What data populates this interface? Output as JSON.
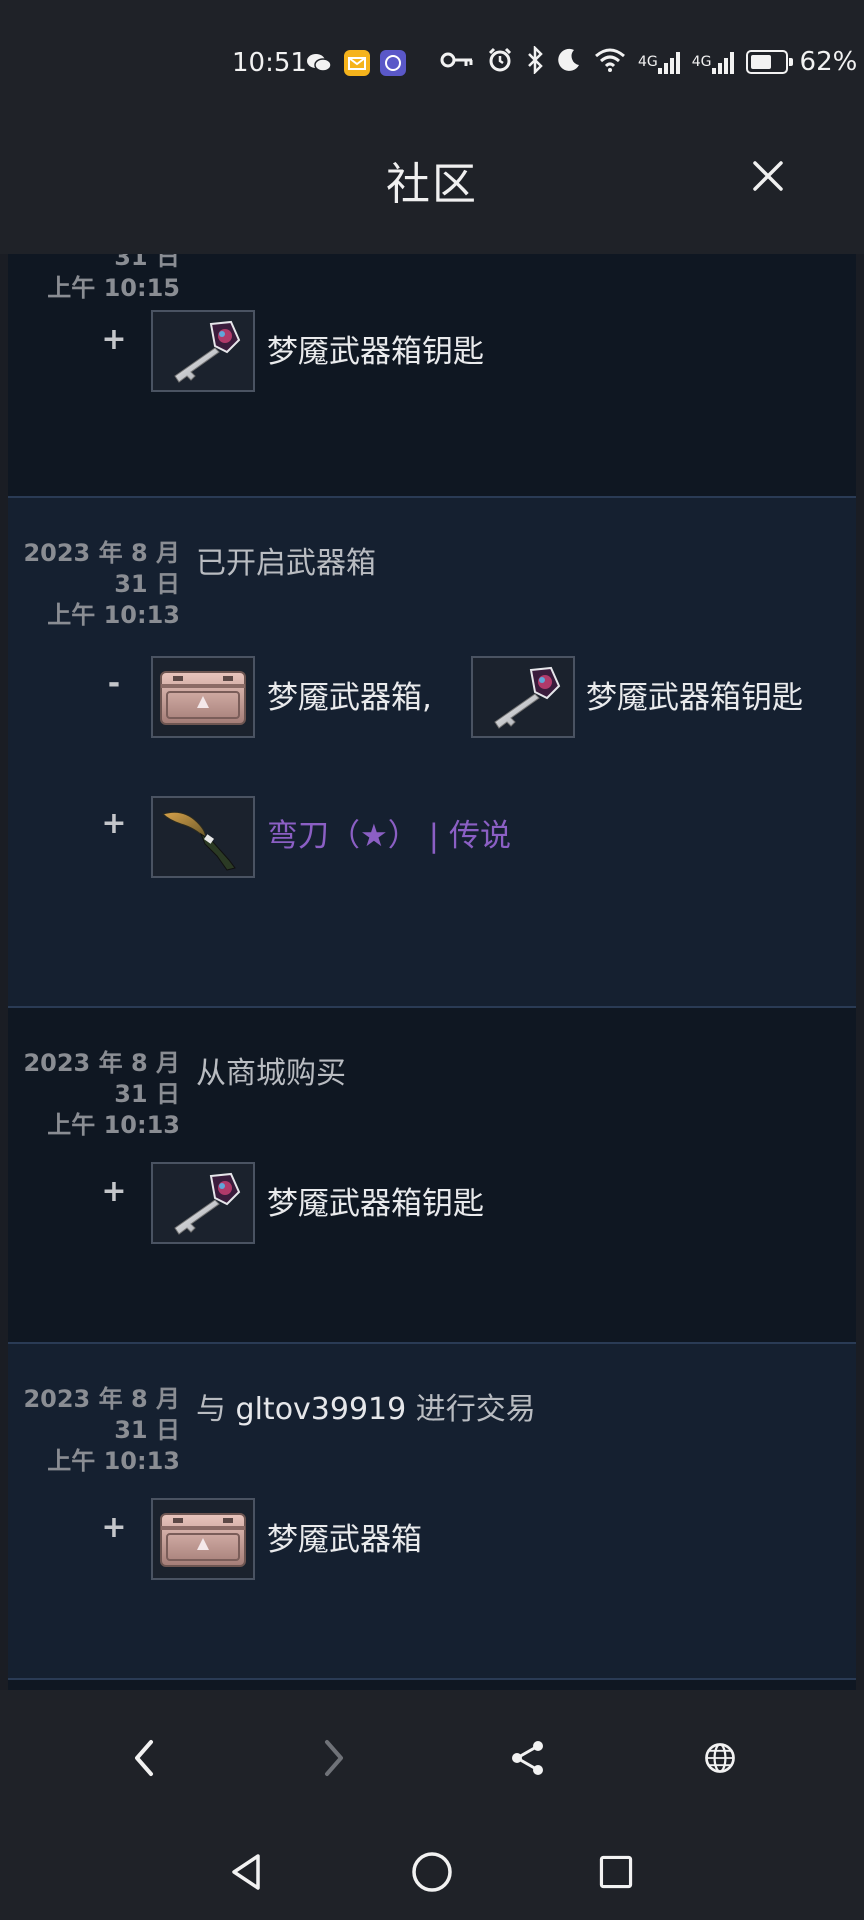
{
  "status_bar": {
    "time": "10:51",
    "battery_pct": "62%",
    "battery_level": 0.62,
    "signal_1": "4G",
    "signal_2": "4G",
    "icons": [
      "wechat-icon",
      "mail-icon",
      "app-icon",
      "key-icon",
      "alarm-icon",
      "bluetooth-icon",
      "moon-icon",
      "wifi-icon",
      "signal-icon",
      "signal-icon",
      "battery-icon"
    ]
  },
  "header": {
    "title": "社区",
    "close_icon": "close-icon"
  },
  "entries": [
    {
      "date_partial": "31 日",
      "time": "上午 10:15",
      "items": [
        {
          "sign": "+",
          "name": "梦魇武器箱钥匙",
          "thumb": "key"
        }
      ]
    },
    {
      "date_line1": "2023 年 8 月",
      "date_line2": "31 日",
      "time": "上午 10:13",
      "description": "已开启武器箱",
      "removed": {
        "sign": "-",
        "items": [
          {
            "name": "梦魇武器箱,",
            "thumb": "case"
          },
          {
            "name": "梦魇武器箱钥匙",
            "thumb": "key"
          }
        ]
      },
      "added": {
        "sign": "+",
        "name": "弯刀（★） | 传说",
        "thumb": "knife",
        "color": "#8b5fc4"
      }
    },
    {
      "date_line1": "2023 年 8 月",
      "date_line2": "31 日",
      "time": "上午 10:13",
      "description": "从商城购买",
      "items": [
        {
          "sign": "+",
          "name": "梦魇武器箱钥匙",
          "thumb": "key"
        }
      ]
    },
    {
      "date_line1": "2023 年 8 月",
      "date_line2": "31 日",
      "time": "上午 10:13",
      "description_prefix": "与",
      "description_user": "gltov39919",
      "description_suffix": "进行交易",
      "items": [
        {
          "sign": "+",
          "name": "梦魇武器箱",
          "thumb": "case"
        }
      ]
    }
  ],
  "browser_bar": {
    "buttons": [
      "back-icon",
      "forward-icon",
      "share-icon",
      "globe-icon"
    ]
  },
  "system_bar": {
    "buttons": [
      "back-triangle-icon",
      "home-circle-icon",
      "recents-square-icon"
    ]
  }
}
